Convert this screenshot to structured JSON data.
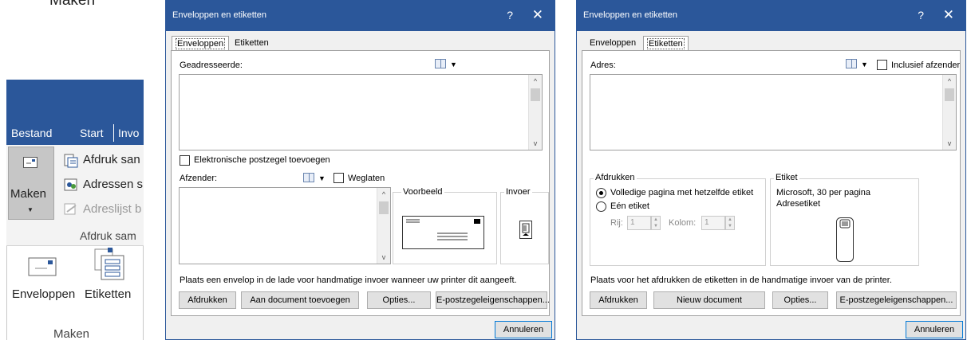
{
  "left": {
    "heading": "Maken",
    "tabs": [
      "Bestand",
      "Start",
      "Invo"
    ],
    "maken_button_label": "Maken",
    "items": [
      "Afdruk san",
      "Adressen s",
      "Adreslijst b"
    ],
    "group_label": "Afdruk sam",
    "dropdown": {
      "envelopes": "Enveloppen",
      "labels": "Etiketten",
      "footer": "Maken"
    }
  },
  "dialog1": {
    "title": "Enveloppen en etiketten",
    "help": "?",
    "close": "✕",
    "tabs": {
      "envelopes": "Enveloppen",
      "labels": "Etiketten"
    },
    "recipient_label": "Geadresseerde:",
    "e_postage_checkbox": "Elektronische postzegel toevoegen",
    "sender_label": "Afzender:",
    "omit_label": "Weglaten",
    "preview_label": "Voorbeeld",
    "feed_label": "Invoer",
    "instruction": "Plaats een envelop in de lade voor handmatige invoer wanneer uw printer dit aangeeft.",
    "buttons": {
      "print": "Afdrukken",
      "add_to_document": "Aan document toevoegen",
      "options": "Opties...",
      "e_postage_props": "E-postzegeleigenschappen...",
      "cancel": "Annuleren"
    }
  },
  "dialog2": {
    "title": "Enveloppen en etiketten",
    "help": "?",
    "close": "✕",
    "tabs": {
      "envelopes": "Enveloppen",
      "labels": "Etiketten"
    },
    "address_label": "Adres:",
    "include_sender": "Inclusief afzender",
    "print_group": "Afdrukken",
    "radio_full_page": "Volledige pagina met hetzelfde etiket",
    "radio_single": "Eén etiket",
    "row_label": "Rij:",
    "row_value": "1",
    "column_label": "Kolom:",
    "column_value": "1",
    "label_group": "Etiket",
    "label_vendor": "Microsoft, 30 per pagina",
    "label_type": "Adresetiket",
    "instruction": "Plaats voor het afdrukken de etiketten in de handmatige invoer van de printer.",
    "buttons": {
      "print": "Afdrukken",
      "new_document": "Nieuw document",
      "options": "Opties...",
      "e_postage_props": "E-postzegeleigenschappen...",
      "cancel": "Annuleren"
    }
  },
  "colors": {
    "title_bar": "#2b579a",
    "ribbon": "#2b579a",
    "dialog_bg": "#f0f0f0",
    "default_button_border": "#0078d7"
  }
}
